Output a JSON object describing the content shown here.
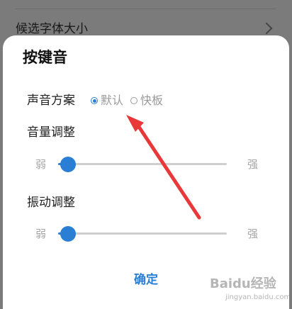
{
  "background": {
    "setting_label": "候选字体大小"
  },
  "dialog": {
    "title": "按键音",
    "sound_scheme": {
      "label": "声音方案",
      "options": [
        {
          "label": "默认",
          "selected": true
        },
        {
          "label": "快板",
          "selected": false
        }
      ]
    },
    "volume": {
      "label": "音量调整",
      "min_label": "弱",
      "max_label": "强",
      "level": 0.06
    },
    "vibration": {
      "label": "振动调整",
      "min_label": "弱",
      "max_label": "强",
      "level": 0.06
    },
    "confirm_label": "确定"
  },
  "watermark": {
    "logo_text": "Baidu经验",
    "url_text": "jingyan.baidu.com"
  },
  "colors": {
    "accent": "#2a7fd4",
    "annotation_arrow": "#e8383a"
  }
}
